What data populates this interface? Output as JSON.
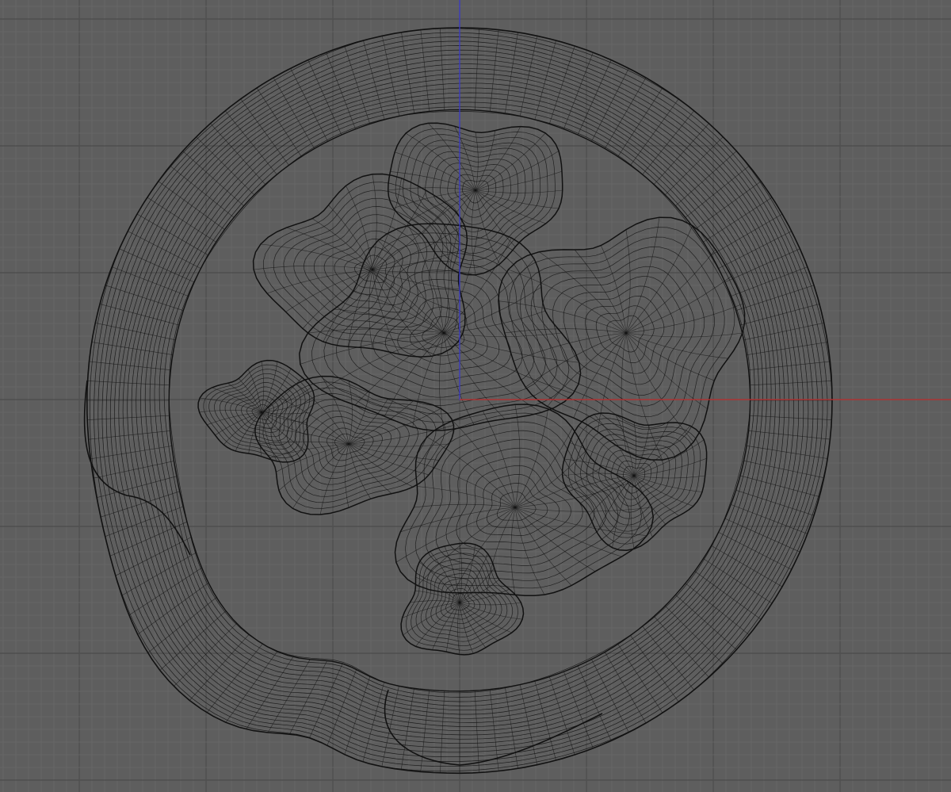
{
  "viewport": {
    "view": "top",
    "shading": "wireframe",
    "background_color": "#5e5e5e",
    "grid": {
      "visible": true,
      "minor_color": "#686868",
      "major_color": "#4f4f4f"
    },
    "axes": {
      "x_axis_color": "#c03030",
      "y_axis_color": "#3a3ad0"
    },
    "mesh": {
      "wire_color": "#111111",
      "description": ""
    }
  }
}
